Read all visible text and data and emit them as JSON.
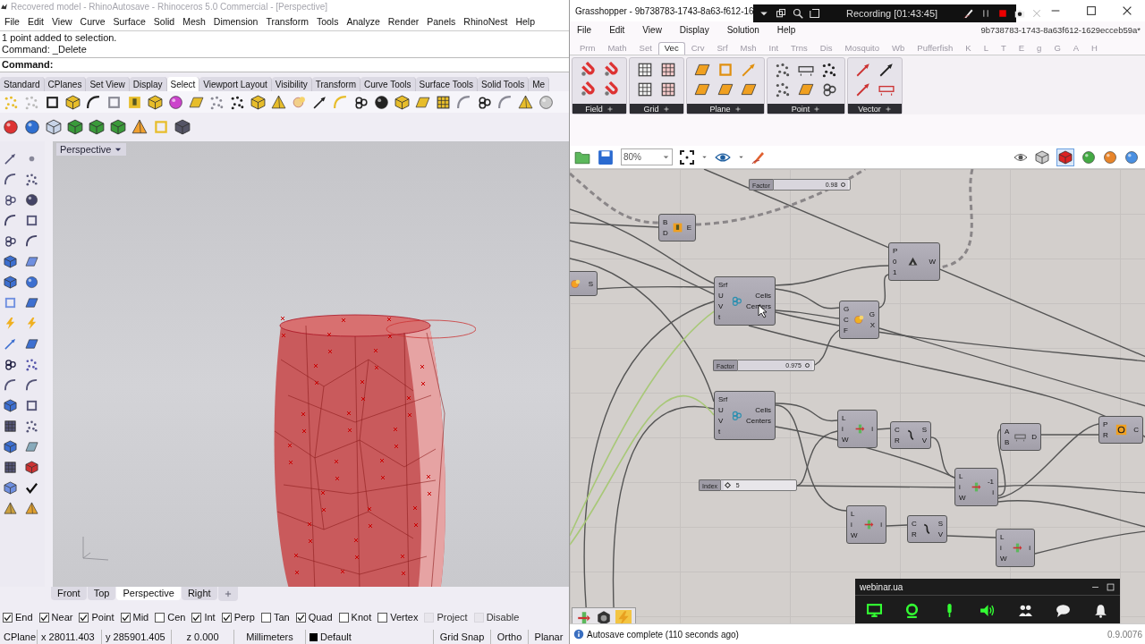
{
  "rhino": {
    "title": "Recovered model - RhinoAutosave - Rhinoceros 5.0 Commercial - [Perspective]",
    "menu": [
      "File",
      "Edit",
      "View",
      "Curve",
      "Surface",
      "Solid",
      "Mesh",
      "Dimension",
      "Transform",
      "Tools",
      "Analyze",
      "Render",
      "Panels",
      "RhinoNest",
      "Help"
    ],
    "command_history": [
      "1 point added to selection.",
      "Command: _Delete"
    ],
    "command_prompt": "Command:",
    "toolbar_tabs": [
      {
        "label": "Standard",
        "selected": false
      },
      {
        "label": "CPlanes",
        "selected": false
      },
      {
        "label": "Set View",
        "selected": false
      },
      {
        "label": "Display",
        "selected": false
      },
      {
        "label": "Select",
        "selected": true
      },
      {
        "label": "Viewport Layout",
        "selected": false
      },
      {
        "label": "Visibility",
        "selected": false
      },
      {
        "label": "Transform",
        "selected": false
      },
      {
        "label": "Curve Tools",
        "selected": false
      },
      {
        "label": "Surface Tools",
        "selected": false
      },
      {
        "label": "Solid Tools",
        "selected": false
      },
      {
        "label": "Me",
        "selected": false
      }
    ],
    "viewport": {
      "label": "Perspective"
    },
    "viewport_tabs": [
      {
        "label": "Front",
        "selected": false
      },
      {
        "label": "Top",
        "selected": false
      },
      {
        "label": "Perspective",
        "selected": true
      },
      {
        "label": "Right",
        "selected": false
      }
    ],
    "osnaps": [
      {
        "label": "End",
        "checked": true,
        "disabled": false
      },
      {
        "label": "Near",
        "checked": true,
        "disabled": false
      },
      {
        "label": "Point",
        "checked": true,
        "disabled": false
      },
      {
        "label": "Mid",
        "checked": true,
        "disabled": false
      },
      {
        "label": "Cen",
        "checked": false,
        "disabled": false
      },
      {
        "label": "Int",
        "checked": true,
        "disabled": false
      },
      {
        "label": "Perp",
        "checked": true,
        "disabled": false
      },
      {
        "label": "Tan",
        "checked": false,
        "disabled": false
      },
      {
        "label": "Quad",
        "checked": true,
        "disabled": false
      },
      {
        "label": "Knot",
        "checked": false,
        "disabled": false
      },
      {
        "label": "Vertex",
        "checked": false,
        "disabled": false
      },
      {
        "label": "Project",
        "checked": false,
        "disabled": true
      },
      {
        "label": "Disable",
        "checked": false,
        "disabled": true
      }
    ],
    "status_bar": [
      {
        "kind": "label",
        "text": "CPlane"
      },
      {
        "kind": "label",
        "text": "x 28011.403"
      },
      {
        "kind": "label",
        "text": "y 285901.405"
      },
      {
        "kind": "label",
        "text": "z 0.000"
      },
      {
        "kind": "label",
        "text": "Millimeters"
      },
      {
        "kind": "layer",
        "text": "Default"
      },
      {
        "kind": "toggle",
        "text": "Grid Snap"
      },
      {
        "kind": "toggle",
        "text": "Ortho"
      },
      {
        "kind": "toggle",
        "text": "Planar"
      }
    ]
  },
  "grasshopper": {
    "title": "Grasshopper - 9b738783-1743-8a63-f612-16",
    "menu": [
      "File",
      "Edit",
      "View",
      "Display",
      "Solution",
      "Help"
    ],
    "document_id": "9b738783-1743-8a63f612-1629ecceb59a*",
    "tabs": [
      {
        "label": "Prm",
        "selected": false
      },
      {
        "label": "Math",
        "selected": false
      },
      {
        "label": "Set",
        "selected": false
      },
      {
        "label": "Vec",
        "selected": true
      },
      {
        "label": "Crv",
        "selected": false
      },
      {
        "label": "Srf",
        "selected": false
      },
      {
        "label": "Msh",
        "selected": false
      },
      {
        "label": "Int",
        "selected": false
      },
      {
        "label": "Trns",
        "selected": false
      },
      {
        "label": "Dis",
        "selected": false
      },
      {
        "label": "Mosquito",
        "selected": false
      },
      {
        "label": "Wb",
        "selected": false
      },
      {
        "label": "Pufferfish",
        "selected": false
      },
      {
        "label": "K",
        "selected": false
      },
      {
        "label": "L",
        "selected": false
      },
      {
        "label": "T",
        "selected": false
      },
      {
        "label": "E",
        "selected": false
      },
      {
        "label": "g",
        "selected": false
      },
      {
        "label": "G",
        "selected": false
      },
      {
        "label": "A",
        "selected": false
      },
      {
        "label": "H",
        "selected": false
      }
    ],
    "ribbon_groups": [
      "Field",
      "Grid",
      "Plane",
      "Point",
      "Vector"
    ],
    "zoom": "80%",
    "nodes": [
      {
        "kind": "slider",
        "label": "Factor",
        "value": "0.98",
        "level": 0.98
      },
      {
        "kind": "component",
        "inputs": [
          "B",
          "D"
        ],
        "outputs": [
          "E"
        ]
      },
      {
        "kind": "component",
        "outputs": [
          "S"
        ]
      },
      {
        "kind": "component",
        "inputs": [
          "Srf",
          "U",
          "V",
          "t"
        ],
        "outputs": [
          "Cells",
          "Centers"
        ]
      },
      {
        "kind": "component",
        "inputs": [
          "P",
          "0",
          "1"
        ],
        "outputs": [
          "W"
        ]
      },
      {
        "kind": "component",
        "inputs": [
          "G",
          "C",
          "F"
        ],
        "outputs": [
          "G",
          "X"
        ]
      },
      {
        "kind": "slider",
        "label": "Factor",
        "value": "0.975",
        "level": 0.975
      },
      {
        "kind": "component",
        "inputs": [
          "Srf",
          "U",
          "V",
          "t"
        ],
        "outputs": [
          "Cells",
          "Centers"
        ]
      },
      {
        "kind": "component",
        "inputs": [
          "L",
          "i",
          "W"
        ],
        "outputs": [
          "i"
        ]
      },
      {
        "kind": "component",
        "inputs": [
          "C",
          "R"
        ],
        "outputs": [
          "S",
          "V"
        ]
      },
      {
        "kind": "component",
        "inputs": [
          "A",
          "B"
        ],
        "outputs": [
          "D"
        ]
      },
      {
        "kind": "component",
        "inputs": [
          "P",
          "R"
        ],
        "outputs": [
          "C"
        ]
      },
      {
        "kind": "integer_slider",
        "label": "Index",
        "value": "5",
        "level": 0.03
      },
      {
        "kind": "component",
        "inputs": [
          "L",
          "i",
          "W"
        ],
        "outputs": [
          "-1",
          "i"
        ]
      },
      {
        "kind": "component",
        "inputs": [
          "L",
          "i",
          "W"
        ],
        "outputs": [
          "i"
        ]
      },
      {
        "kind": "component",
        "inputs": [
          "C",
          "R"
        ],
        "outputs": [
          "S",
          "V"
        ]
      },
      {
        "kind": "component",
        "inputs": [
          "L",
          "i",
          "W"
        ],
        "outputs": [
          "i"
        ]
      }
    ],
    "status": "Autosave complete (110 seconds ago)",
    "version": "0.9.0076"
  },
  "recording": {
    "text": "Recording [01:43:45]"
  },
  "webinar": {
    "title": "webinar.ua"
  }
}
